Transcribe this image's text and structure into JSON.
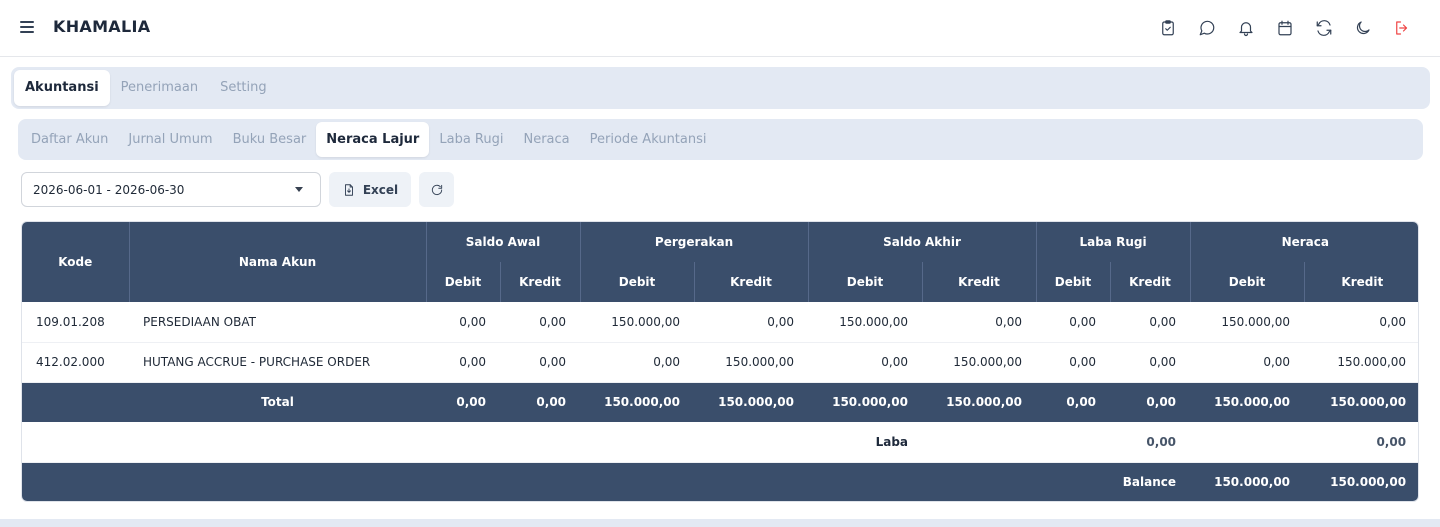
{
  "app": {
    "title": "KHAMALIA"
  },
  "topbar_icons": [
    "clipboard-check-icon",
    "chat-icon",
    "bell-icon",
    "calendar-icon",
    "refresh-icon",
    "moon-icon",
    "logout-icon"
  ],
  "main_tabs": [
    {
      "label": "Akuntansi",
      "active": true
    },
    {
      "label": "Penerimaan",
      "active": false
    },
    {
      "label": "Setting",
      "active": false
    }
  ],
  "sub_tabs": [
    {
      "label": "Daftar Akun",
      "active": false
    },
    {
      "label": "Jurnal Umum",
      "active": false
    },
    {
      "label": "Buku Besar",
      "active": false
    },
    {
      "label": "Neraca Lajur",
      "active": true
    },
    {
      "label": "Laba Rugi",
      "active": false
    },
    {
      "label": "Neraca",
      "active": false
    },
    {
      "label": "Periode Akuntansi",
      "active": false
    }
  ],
  "toolbar": {
    "date_range": "2026-06-01 - 2026-06-30",
    "excel_label": "Excel"
  },
  "table": {
    "headers": {
      "kode": "Kode",
      "nama_akun": "Nama Akun",
      "saldo_awal": "Saldo Awal",
      "pergerakan": "Pergerakan",
      "saldo_akhir": "Saldo Akhir",
      "laba_rugi": "Laba Rugi",
      "neraca": "Neraca",
      "debit": "Debit",
      "kredit": "Kredit"
    },
    "rows": [
      {
        "kode": "109.01.208",
        "nama": "PERSEDIAAN OBAT",
        "values": [
          "0,00",
          "0,00",
          "150.000,00",
          "0,00",
          "150.000,00",
          "0,00",
          "0,00",
          "0,00",
          "150.000,00",
          "0,00"
        ]
      },
      {
        "kode": "412.02.000",
        "nama": "HUTANG ACCRUE - PURCHASE ORDER",
        "values": [
          "0,00",
          "0,00",
          "0,00",
          "150.000,00",
          "0,00",
          "150.000,00",
          "0,00",
          "0,00",
          "0,00",
          "150.000,00"
        ]
      }
    ],
    "total": {
      "label": "Total",
      "values": [
        "0,00",
        "0,00",
        "150.000,00",
        "150.000,00",
        "150.000,00",
        "150.000,00",
        "0,00",
        "0,00",
        "150.000,00",
        "150.000,00"
      ]
    },
    "laba": {
      "label": "Laba",
      "laba_rugi_kredit": "0,00",
      "neraca_kredit": "0,00"
    },
    "balance": {
      "label": "Balance",
      "neraca_debit": "150.000,00",
      "neraca_kredit": "150.000,00"
    }
  }
}
